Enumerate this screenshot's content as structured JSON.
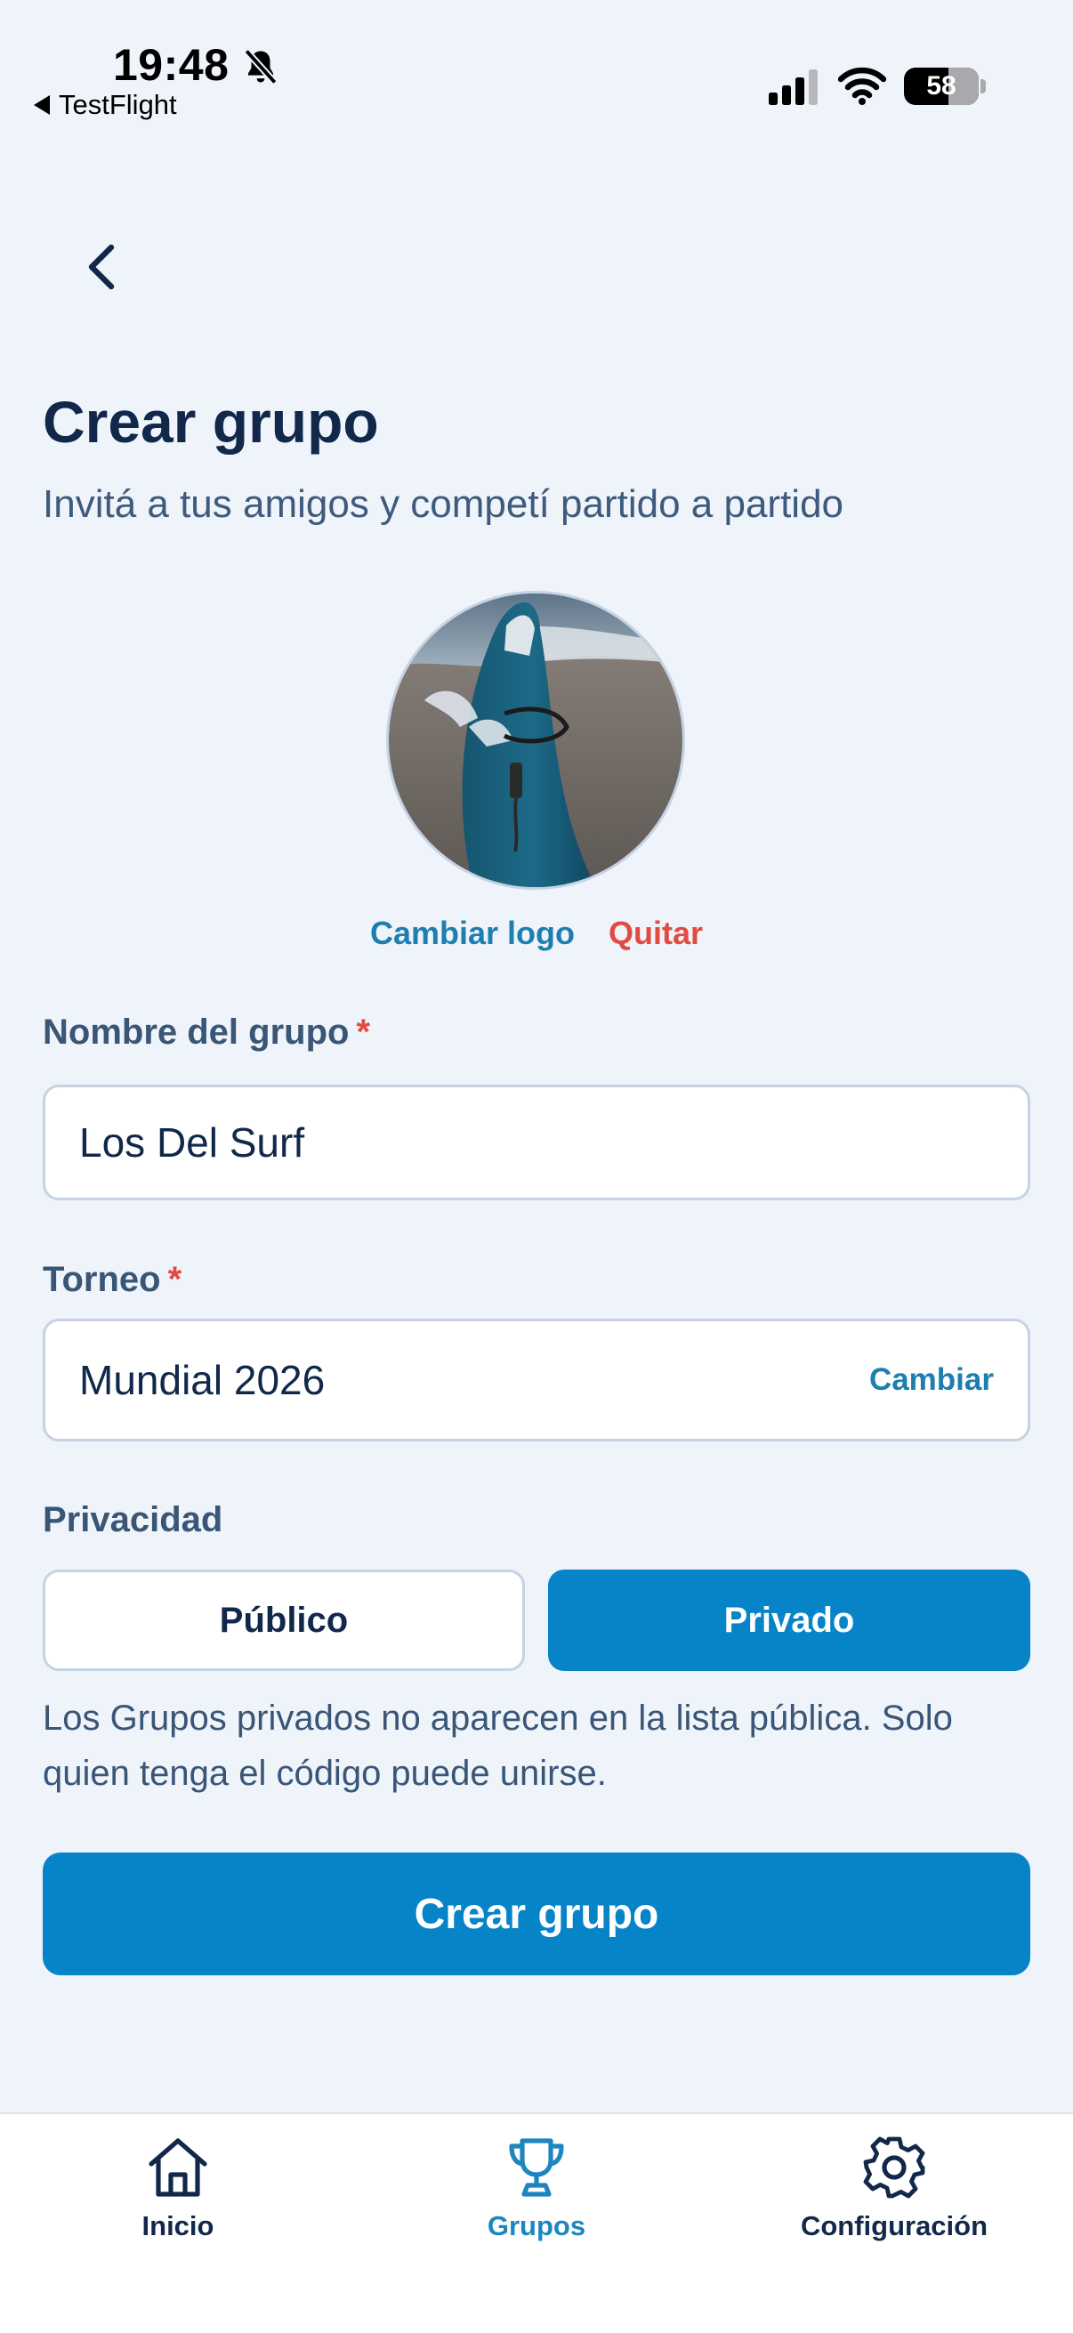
{
  "status_bar": {
    "time": "19:48",
    "back_app": "TestFlight",
    "battery": "58"
  },
  "header": {
    "title": "Crear grupo",
    "subtitle": "Invitá a tus amigos y competí partido a partido"
  },
  "logo": {
    "change_label": "Cambiar logo",
    "remove_label": "Quitar"
  },
  "form": {
    "name_label": "Nombre del grupo",
    "name_value": "Los Del Surf",
    "tournament_label": "Torneo",
    "tournament_value": "Mundial 2026",
    "tournament_change": "Cambiar",
    "required_mark": "*",
    "privacy_label": "Privacidad",
    "privacy_options": [
      "Público",
      "Privado"
    ],
    "privacy_selected": "Privado",
    "privacy_help": "Los Grupos privados no aparecen en la lista pública. Solo quien tenga el código puede unirse.",
    "submit_label": "Crear grupo"
  },
  "tabbar": {
    "items": [
      {
        "label": "Inicio",
        "icon": "home-icon"
      },
      {
        "label": "Grupos",
        "icon": "trophy-icon"
      },
      {
        "label": "Configuración",
        "icon": "gear-icon"
      }
    ],
    "active": "Grupos"
  },
  "colors": {
    "accent": "#0784c8",
    "link": "#1d7fb0",
    "danger": "#e24a42",
    "background": "#eff3fa",
    "text_dark": "#12284a"
  }
}
